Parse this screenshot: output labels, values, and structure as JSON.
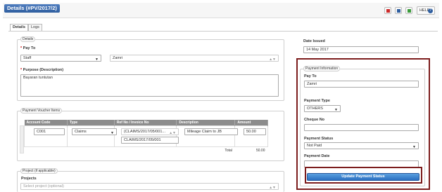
{
  "window": {
    "title": "Details (#PV/2017/2)",
    "help_label": "HELP",
    "help_icon_glyph": "?",
    "icon_colors": [
      "#cc2a2a",
      "#2f5e9f",
      "#3a9a3a"
    ]
  },
  "tabs": [
    {
      "label": "Details",
      "active": true
    },
    {
      "label": "Logs",
      "active": false
    }
  ],
  "details": {
    "legend": "Details",
    "pay_to_label": "Pay To",
    "pay_to_type": "Staff",
    "pay_to_name": "Zamri",
    "purpose_label": "Purpose (Description)",
    "purpose_value": "Bayaran tuntutan",
    "required_mark": "*",
    "select_arrow": "▼",
    "select_arrow_small": "▲▼"
  },
  "items": {
    "legend": "Payment Voucher Items",
    "headers": [
      "Account Code",
      "Type",
      "Ref No / Invoice No",
      "Description",
      "Amount"
    ],
    "row": {
      "account_code": "C001",
      "type": "Claims",
      "ref_select": "(CLAIMS/2017/05/001...",
      "ref_input": "CLAIMS/2017/05/001",
      "description": "Mileage Claim to JB",
      "amount": "50.00"
    },
    "total_label": "Total",
    "total_value": "50.00"
  },
  "project": {
    "legend": "Project (if applicable)",
    "label": "Projects",
    "placeholder": "Select project (optional)"
  },
  "right": {
    "date_issued_label": "Date Issued",
    "date_issued_value": "14 May 2017",
    "payment_info_legend": "Payment Information",
    "pay_to_label": "Pay To",
    "pay_to_value": "Zamri",
    "payment_type_label": "Payment Type",
    "payment_type_value": "OTHERS",
    "cheque_no_label": "Cheque No",
    "cheque_no_value": "",
    "payment_status_label": "Payment Status",
    "payment_status_value": "Not Paid",
    "payment_date_label": "Payment Date",
    "payment_date_value": "",
    "update_button": "Update Payment Status"
  }
}
